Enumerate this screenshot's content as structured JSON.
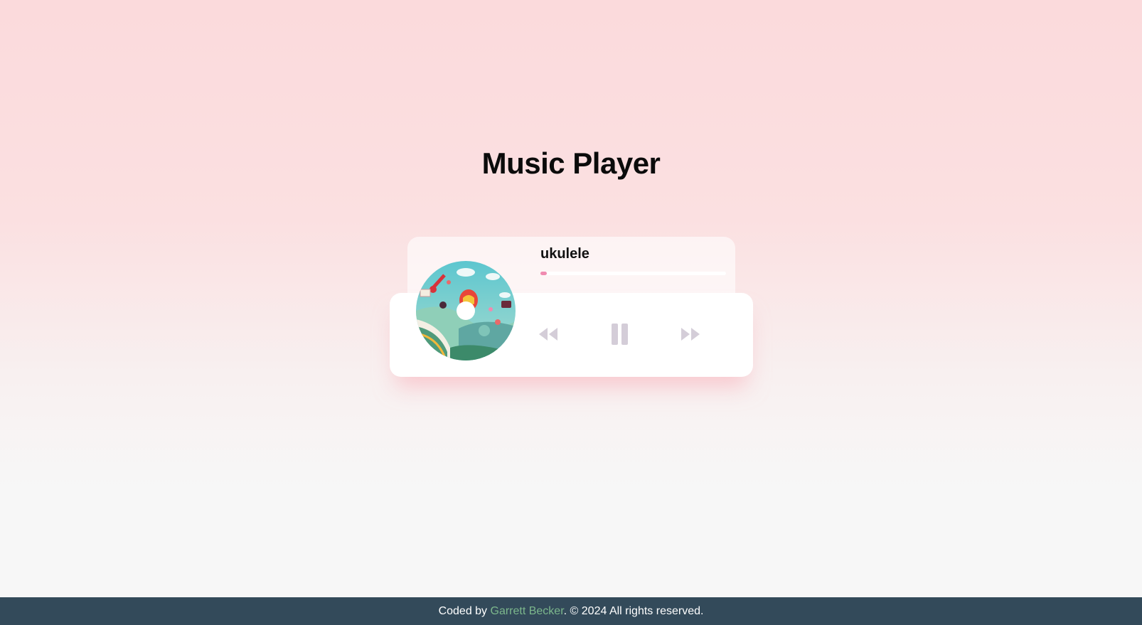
{
  "page": {
    "title": "Music Player"
  },
  "player": {
    "track_title": "ukulele",
    "progress_fraction": 0.035,
    "state": "playing",
    "controls": {
      "prev_icon": "rewind-icon",
      "play_pause_icon": "pause-icon",
      "next_icon": "fast-forward-icon"
    },
    "album_art_icon": "album-art-disc"
  },
  "footer": {
    "prefix": "Coded by ",
    "author": "Garrett Becker",
    "suffix": ". © 2024 All rights reserved."
  },
  "colors": {
    "accent": "#f08bb0",
    "control_icon": "#d4cdd8",
    "footer_bg": "#334a5a",
    "author_link": "#7cb78c"
  }
}
